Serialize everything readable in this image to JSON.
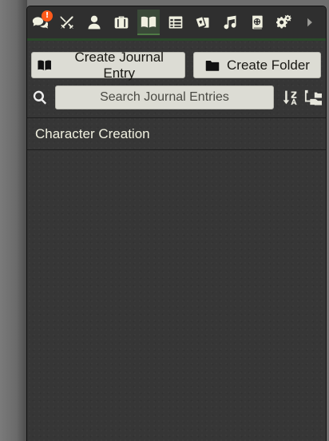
{
  "sidebar": {
    "tabs": [
      {
        "name": "chat",
        "icon": "comments-icon",
        "badge": "!"
      },
      {
        "name": "combat",
        "icon": "crossed-swords-icon"
      },
      {
        "name": "actors",
        "icon": "user-icon"
      },
      {
        "name": "items",
        "icon": "suitcase-icon"
      },
      {
        "name": "journal",
        "icon": "book-open-icon",
        "active": true
      },
      {
        "name": "tables",
        "icon": "table-list-icon"
      },
      {
        "name": "cards",
        "icon": "cards-icon"
      },
      {
        "name": "playlists",
        "icon": "music-icon"
      },
      {
        "name": "compendium",
        "icon": "atlas-icon"
      },
      {
        "name": "settings",
        "icon": "cogs-icon"
      },
      {
        "name": "collapse",
        "icon": "caret-right-icon"
      }
    ],
    "colors": {
      "accent_badge": "#ff5a1a",
      "active_tab_border": "#4f7a46"
    }
  },
  "actions": {
    "create_entry_label": "Create Journal Entry",
    "create_folder_label": "Create Folder"
  },
  "search": {
    "placeholder": "Search Journal Entries",
    "value": ""
  },
  "journal": {
    "entries": [
      "Character Creation"
    ]
  }
}
